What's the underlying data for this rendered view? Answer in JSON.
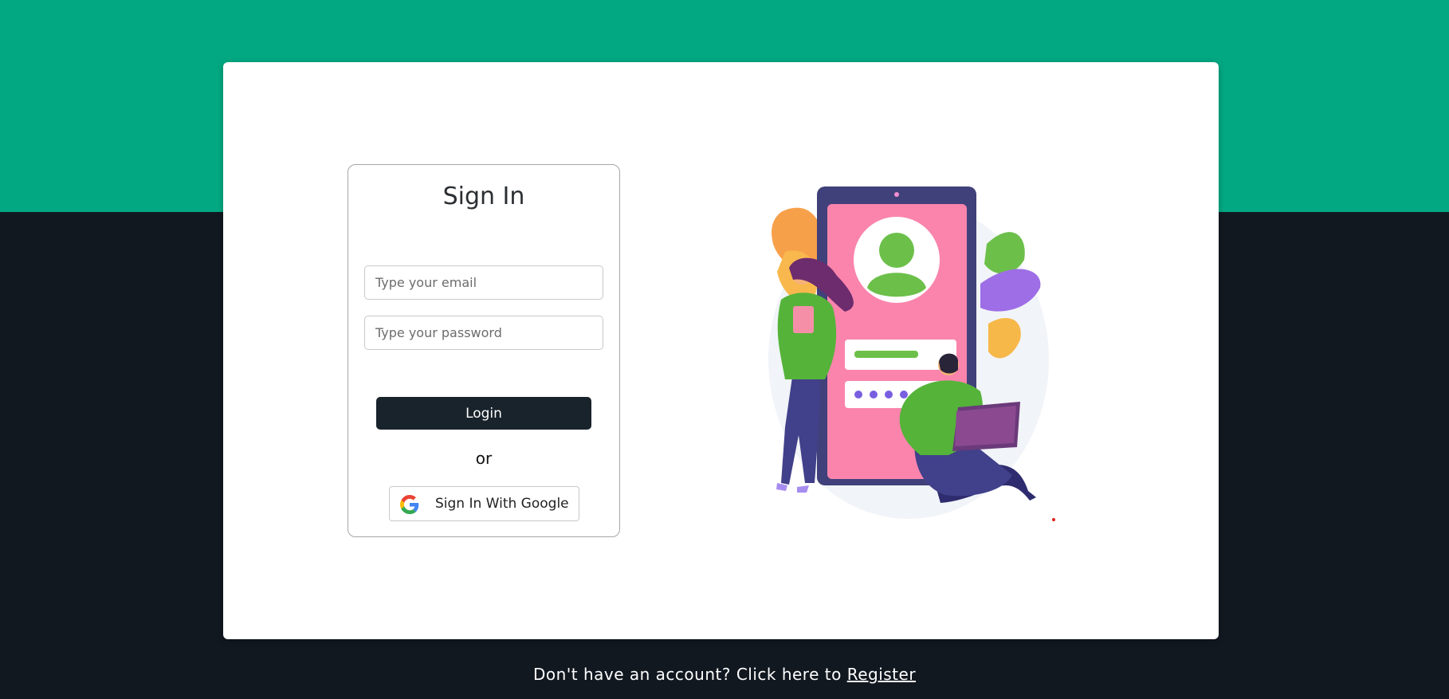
{
  "signin": {
    "title": "Sign In",
    "email_placeholder": "Type your email",
    "password_placeholder": "Type your password",
    "login_label": "Login",
    "or_label": "or",
    "google_label": "Sign In With Google"
  },
  "footer": {
    "prompt": "Don't have an account? Click here to",
    "register_label": "Register"
  },
  "colors": {
    "top_band": "#02a882",
    "background": "#121820",
    "card": "#ffffff",
    "login_button": "#19232b"
  },
  "icons": {
    "google": "google-icon"
  }
}
